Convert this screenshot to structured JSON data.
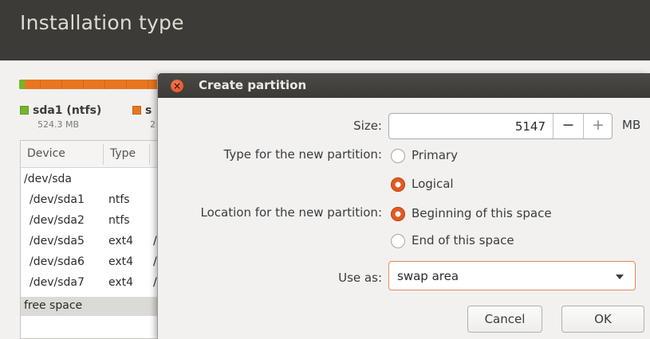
{
  "header": {
    "title": "Installation type"
  },
  "legend": [
    {
      "name": "sda1 (ntfs)",
      "size": "524.3 MB",
      "color": "#71b72c"
    },
    {
      "name": "s",
      "size": "2",
      "color": "#e8761f"
    }
  ],
  "tree": {
    "columns": [
      "Device",
      "Type"
    ],
    "rows": [
      {
        "device": "/dev/sda",
        "type": "",
        "extra": ""
      },
      {
        "device": "/dev/sda1",
        "type": "ntfs",
        "extra": ""
      },
      {
        "device": "/dev/sda2",
        "type": "ntfs",
        "extra": ""
      },
      {
        "device": "/dev/sda5",
        "type": "ext4",
        "extra": "/"
      },
      {
        "device": "/dev/sda6",
        "type": "ext4",
        "extra": "/"
      },
      {
        "device": "/dev/sda7",
        "type": "ext4",
        "extra": "/"
      },
      {
        "device": "free space",
        "type": "",
        "extra": ""
      }
    ]
  },
  "dialog": {
    "title": "Create partition",
    "close_glyph": "×",
    "size_label": "Size:",
    "size_value": "5147",
    "minus": "−",
    "plus": "+",
    "unit": "MB",
    "type_label": "Type for the new partition:",
    "type_options": [
      {
        "label": "Primary",
        "selected": false
      },
      {
        "label": "Logical",
        "selected": true
      }
    ],
    "location_label": "Location for the new partition:",
    "location_options": [
      {
        "label": "Beginning of this space",
        "selected": true
      },
      {
        "label": "End of this space",
        "selected": false
      }
    ],
    "use_as_label": "Use as:",
    "use_as_value": "swap area",
    "cancel": "Cancel",
    "ok": "OK",
    "accent_color": "#e05a24"
  }
}
